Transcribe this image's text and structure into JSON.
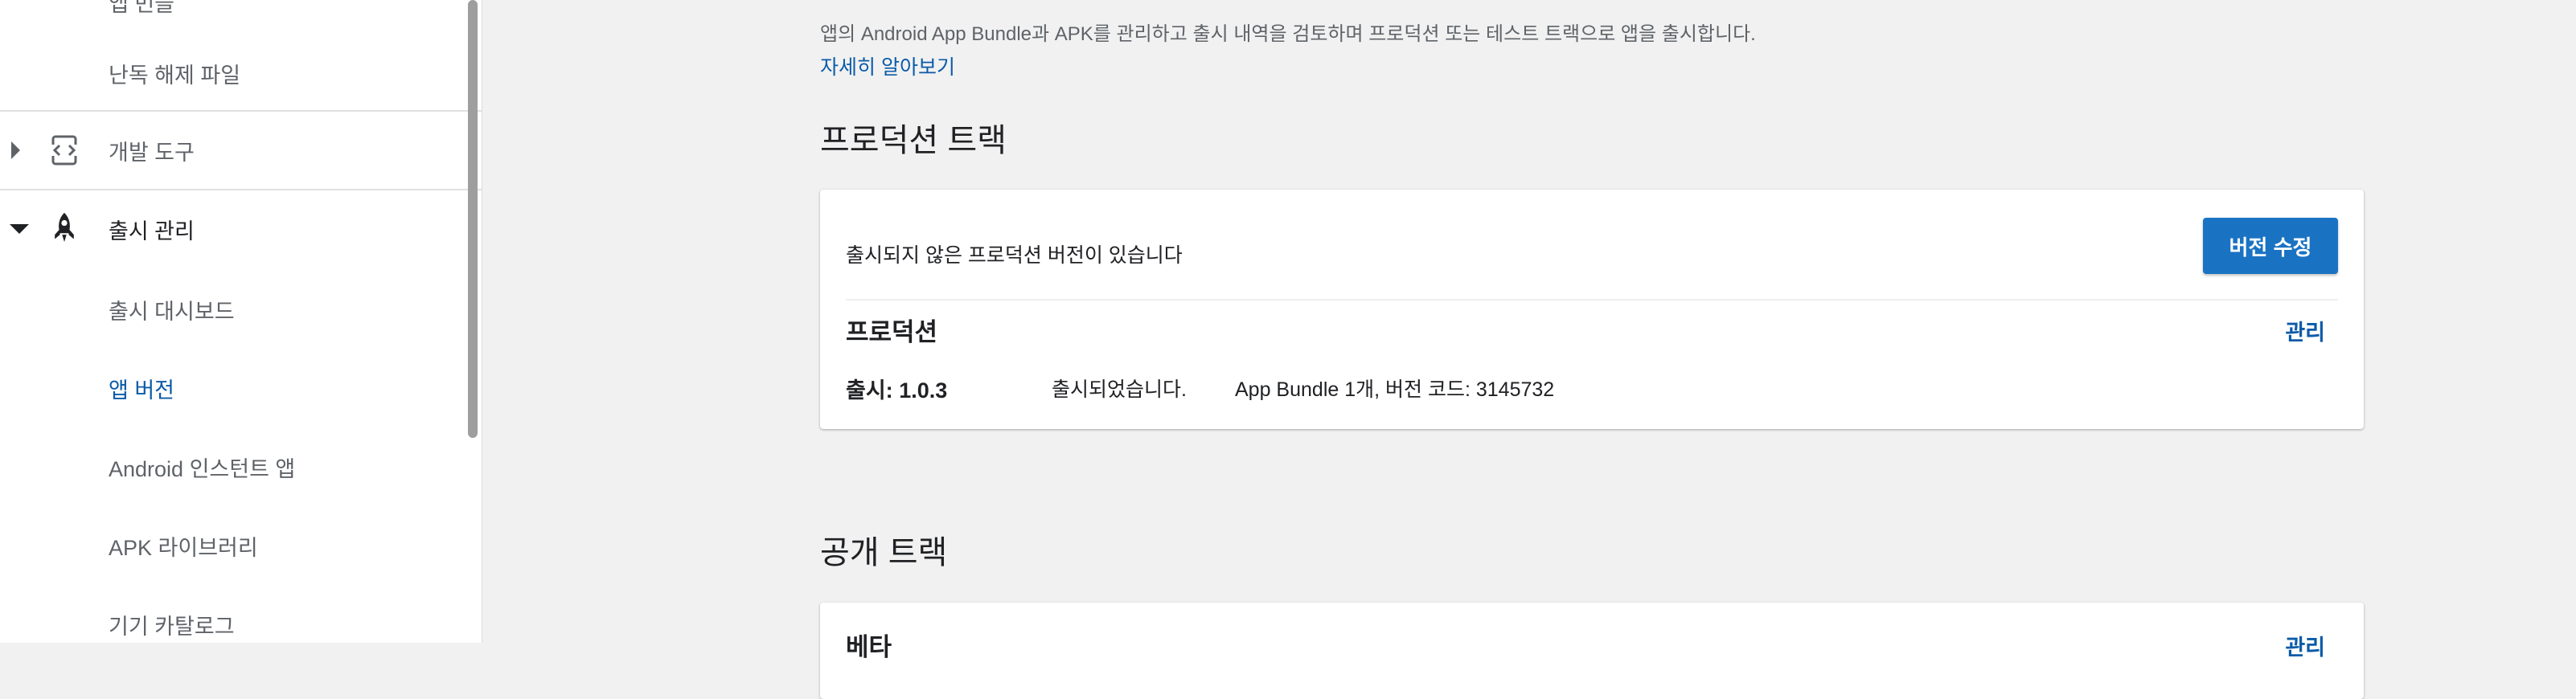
{
  "sidebar": {
    "top_partial_label": "앱 번들",
    "items": [
      {
        "label": "난독 해제 파일"
      },
      {
        "label": "개발 도구"
      },
      {
        "label": "출시 관리"
      },
      {
        "label": "출시 대시보드"
      },
      {
        "label": "앱 버전"
      },
      {
        "label": "Android 인스턴트 앱"
      },
      {
        "label": "APK 라이브러리"
      },
      {
        "label": "기기 카탈로그"
      }
    ]
  },
  "main": {
    "description": "앱의 Android App Bundle과 APK를 관리하고 출시 내역을 검토하며 프로덕션 또는 테스트 트랙으로 앱을 출시합니다.",
    "learn_more": "자세히 알아보기",
    "production": {
      "section_title": "프로덕션 트랙",
      "notice": "출시되지 않은 프로덕션 버전이 있습니다",
      "edit_button": "버전 수정",
      "track_name": "프로덕션",
      "manage": "관리",
      "release_prefix": "출시:",
      "release_version": "1.0.3",
      "release_status": "출시되었습니다.",
      "release_detail": "App Bundle 1개, 버전 코드: 3145732"
    },
    "open": {
      "section_title": "공개 트랙",
      "track_name": "베타",
      "manage": "관리"
    }
  },
  "colors": {
    "accent": "#0b5ba8",
    "button": "#1a73c2",
    "background": "#f1f1f1"
  }
}
